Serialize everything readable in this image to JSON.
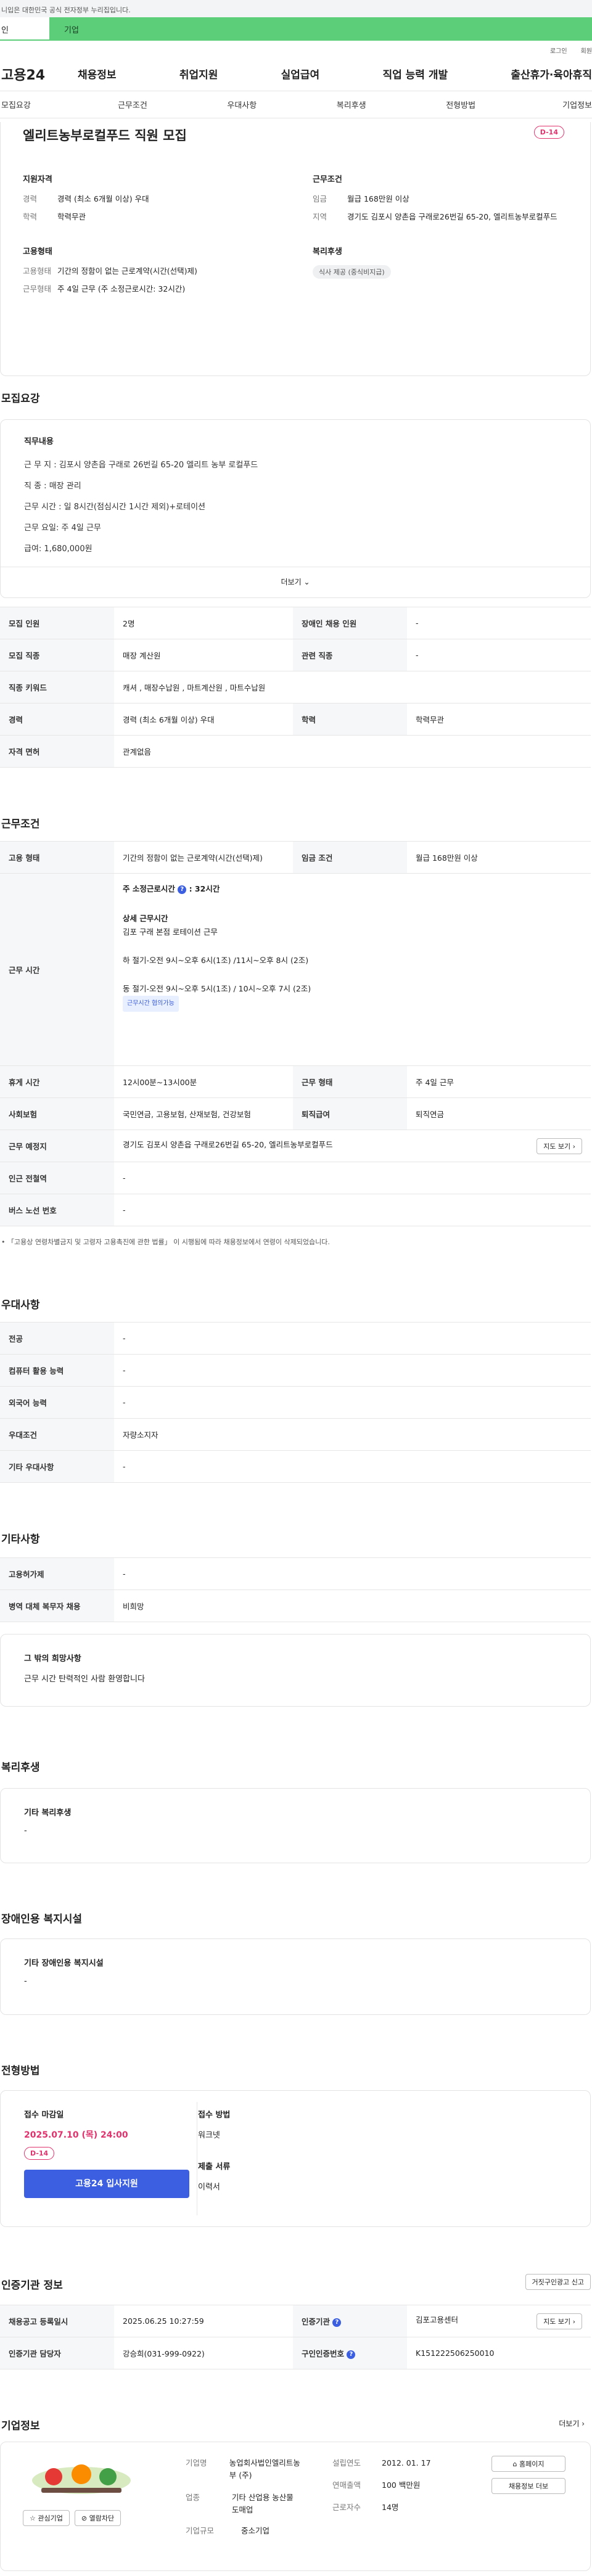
{
  "banner": {
    "text": "니입은 대한민국 공식 전자정부 누리집입니다."
  },
  "top_tabs": {
    "personal": "인",
    "company": "기업"
  },
  "util_links": {
    "login": "로그인",
    "join": "회원"
  },
  "gnb": {
    "logo": "고용24",
    "items": [
      "채용정보",
      "취업지원",
      "실업급여",
      "직업 능력 개발",
      "출산휴가·육아휴직"
    ]
  },
  "subnav": [
    "모집요강",
    "근무조건",
    "우대사항",
    "복리후생",
    "전형방법",
    "기업정보"
  ],
  "summary": {
    "title": "엘리트농부로컬푸드 직원 모집",
    "dday": "D-14",
    "qual": {
      "heading": "지원자격",
      "career_k": "경력",
      "career_v": "경력 (최소 6개월 이상) 우대",
      "edu_k": "학력",
      "edu_v": "학력무관"
    },
    "cond": {
      "heading": "근무조건",
      "pay_k": "임금",
      "pay_v": "월급 168만원 이상",
      "loc_k": "지역",
      "loc_v": "경기도 김포시 양촌읍 구래로26번길 65-20, 엘리트농부로컬푸드"
    },
    "emp": {
      "heading": "고용형태",
      "type_k": "고용형태",
      "type_v": "기간의 정함이 없는 근로계약(시간(선택)제)",
      "shift_k": "근무형태",
      "shift_v": "주 4일 근무 (주 소정근로시간: 32시간)"
    },
    "welfare": {
      "heading": "복리후생",
      "chip": "식사 제공 (중식비지급)"
    }
  },
  "recruit": {
    "title": "모집요강",
    "box_heading": "직무내용",
    "lines": [
      "근 무 지 : 김포시 양촌읍 구래로 26번길 65-20 엘리트 농부 로컬푸드",
      "직      종 : 매장 관리",
      "근무 시간 : 일 8시간(점심시간 1시간 제외)+로테이션",
      "근무  요일:  주 4일 근무",
      "급여: 1,680,000원"
    ],
    "more": "더보기"
  },
  "recruit_table": [
    {
      "k1": "모집 인원",
      "v1": "2명",
      "k2": "장애인 채용 인원",
      "v2": "-"
    },
    {
      "k1": "모집 직종",
      "v1": "매장 계산원",
      "k2": "관련 직종",
      "v2": "-"
    },
    {
      "k1": "직종 키워드",
      "v1": "캐셔 , 매장수납원 , 마트계산원 , 마트수납원"
    },
    {
      "k1": "경력",
      "v1": "경력 (최소 6개월 이상) 우대",
      "k2": "학력",
      "v2": "학력무관"
    },
    {
      "k1": "자격 면허",
      "v1": "관계없음"
    }
  ],
  "conditions": {
    "title": "근무조건",
    "emp_type_k": "고용 형태",
    "emp_type_v": "기간의 정함이 없는 근로계약(시간(선택)제)",
    "wage_k": "임금 조건",
    "wage_v": "월급 168만원 이상",
    "hours_k": "근무 시간",
    "weekly_label": "주 소정근로시간",
    "weekly_value": "32시간",
    "detail_label": "상세 근무시간",
    "detail_lines": [
      "김포 구래 본점 로테이션 근무",
      "하 절기-오전 9시~오후 6시(1조) /11시~오후 8시 (2조)",
      "동 절기-오전 9시~오후 5시(1조) / 10시~오후 7시 (2조)"
    ],
    "hours_tag": "근무시간 협의가능",
    "break_k": "휴게 시간",
    "break_v": "12시00분~13시00분",
    "shift_k": "근무 형태",
    "shift_v": "주 4일 근무",
    "ins_k": "사회보험",
    "ins_v": "국민연금, 고용보험, 산재보험, 건강보험",
    "sev_k": "퇴직급여",
    "sev_v": "퇴직연금",
    "place_k": "근무 예정지",
    "place_v": "경기도 김포시 양촌읍 구래로26번길 65-20, 엘리트농부로컬푸드",
    "map_btn": "지도 보기",
    "subway_k": "인근 전철역",
    "subway_v": "-",
    "bus_k": "버스 노선 번호",
    "bus_v": "-",
    "note": "「고용상 연령차별금지 및 고령자 고용촉진에 관한 법률」 이 시행됨에 따라 채용정보에서 연령이 삭제되었습니다."
  },
  "preference": {
    "title": "우대사항",
    "rows": [
      {
        "k": "전공",
        "v": "-"
      },
      {
        "k": "컴퓨터 활용 능력",
        "v": "-"
      },
      {
        "k": "외국어 능력",
        "v": "-"
      },
      {
        "k": "우대조건",
        "v": "자량소지자"
      },
      {
        "k": "기타 우대사항",
        "v": "-"
      }
    ]
  },
  "other": {
    "title": "기타사항",
    "rows": [
      {
        "k": "고용허가제",
        "v": "-"
      },
      {
        "k": "병역 대체 복무자 채용",
        "v": "비희망"
      }
    ],
    "box_heading": "그 밖의 희망사항",
    "box_text": "근무 시간 탄력적인 사람 환영합니다"
  },
  "welfare": {
    "title": "복리후생",
    "box_heading": "기타 복리후생",
    "box_text": "-"
  },
  "disabled": {
    "title": "장애인용 복지시설",
    "box_heading": "기타 장애인용 복지시설",
    "box_text": "-"
  },
  "selection": {
    "title": "전형방법",
    "deadline_heading": "접수 마감일",
    "deadline": "2025.07.10 (목) 24:00",
    "dday": "D-14",
    "apply_btn": "고용24 입사지원",
    "method_heading": "접수 방법",
    "method": "워크넷",
    "docs_heading": "제출 서류",
    "docs": "이력서"
  },
  "agency": {
    "title": "인증기관 정보",
    "report_btn": "거짓구인광고 신고",
    "reg_k": "채용공고 등록일시",
    "reg_v": "2025.06.25 10:27:59",
    "org_k": "인증기관",
    "org_v": "김포고용센터",
    "map_btn": "지도 보기",
    "mgr_k": "인증기관 담당자",
    "mgr_v": "강승희(031-999-0922)",
    "no_k": "구인인증번호",
    "no_v": "K151222506250010"
  },
  "company": {
    "title": "기업정보",
    "more": "더보기",
    "interest_btn": "관심기업",
    "block_btn": "열람차단",
    "name_k": "기업명",
    "name_v": "농업회사법인엘리트농부 (주)",
    "ind_k": "업종",
    "ind_v": "기타 산업용 농산물 도매업",
    "size_k": "기업규모",
    "size_v": "중소기업",
    "est_k": "설립연도",
    "est_v": "2012. 01. 17",
    "sales_k": "연매출액",
    "sales_v": "100 백만원",
    "emp_k": "근로자수",
    "emp_v": "14명",
    "home_btn": "홈페이지",
    "list_btn": "채용정보 더보"
  },
  "colors": {
    "green": "#5cce7a",
    "blue": "#3b5fe0",
    "pink": "#e0336d"
  }
}
